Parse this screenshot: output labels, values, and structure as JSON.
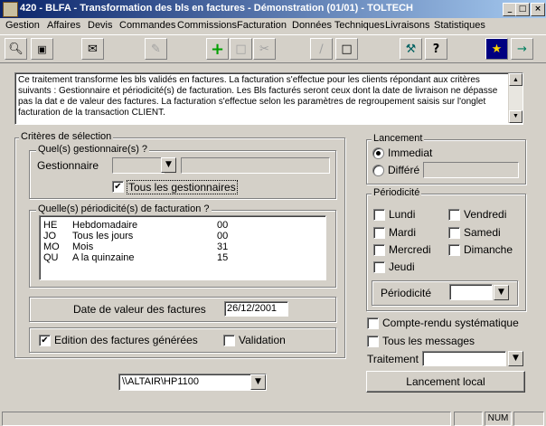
{
  "window": {
    "title": "420 - BLFA - Transformation des bls en factures - Démonstration (01/01) - TOLTECH",
    "minimize": "_",
    "maximize": "□",
    "close": "×"
  },
  "menu": [
    "Gestion",
    "Affaires",
    "Devis",
    "Commandes",
    "Commissions",
    "Facturation",
    "Données Techniques",
    "Livraisons",
    "Statistiques"
  ],
  "toolbar_icons": [
    "search-preview-icon",
    "camera-icon",
    "mail-icon",
    "edit-icon",
    "add-icon",
    "save-icon",
    "cut-icon",
    "print-icon",
    "document-icon",
    "tools-icon",
    "help-icon",
    "wizard-icon",
    "exit-icon"
  ],
  "info": {
    "text": "Ce traitement transforme les bls validés en factures. La facturation s'effectue pour les clients répondant aux critères suivants : Gestionnaire et périodicité(s) de facturation. Les Bls facturés seront ceux dont la date de livraison ne dépasse pas la dat e  de valeur des factures. La facturation s'effectue selon les paramètres de regroupement saisis sur l'onglet facturation de la transaction CLIENT."
  },
  "criteres": {
    "legend": "Critères de sélection",
    "gestionnaire_group": "Quel(s) gestionnaire(s) ?",
    "gestionnaire_label": "Gestionnaire",
    "gestionnaire_code": "",
    "gestionnaire_name": "",
    "tous_label": "Tous les gestionnaires",
    "tous_checked": true,
    "periodicite_group": "Quelle(s) périodicité(s) de facturation ?",
    "periodicites": [
      {
        "code": "HE",
        "label": "Hebdomadaire",
        "value": "00"
      },
      {
        "code": "JO",
        "label": "Tous les jours",
        "value": "00"
      },
      {
        "code": "MO",
        "label": "Mois",
        "value": "31"
      },
      {
        "code": "QU",
        "label": "A la quinzaine",
        "value": "15"
      }
    ]
  },
  "date_valeur": {
    "label": "Date de valeur des factures",
    "value": "26/12/2001"
  },
  "edition": {
    "label": "Edition des factures générées",
    "checked": true,
    "validation_label": "Validation",
    "validation_checked": false
  },
  "printer": "\\\\ALTAIR\\HP1100",
  "lancement": {
    "legend": "Lancement",
    "immediat": "Immediat",
    "differe": "Différé",
    "selected": "immediat"
  },
  "periodicite": {
    "legend": "Périodicité",
    "days": [
      "Lundi",
      "Mardi",
      "Mercredi",
      "Jeudi",
      "Vendredi",
      "Samedi",
      "Dimanche"
    ],
    "select_label": "Périodicité"
  },
  "options": {
    "compte_rendu": "Compte-rendu systématique",
    "tous_messages": "Tous les messages",
    "traitement": "Traitement"
  },
  "lancement_button": "Lancement local",
  "status": {
    "num": "NUM"
  }
}
